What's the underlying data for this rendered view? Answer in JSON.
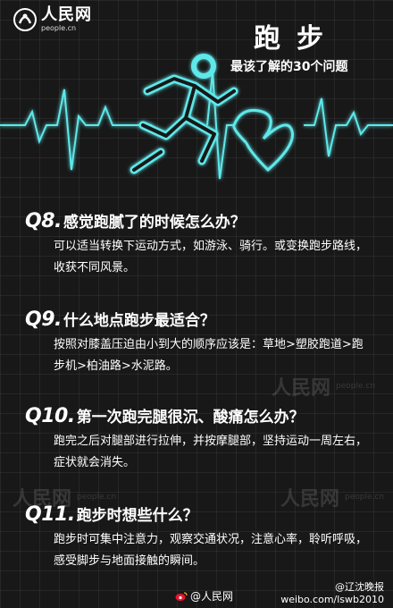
{
  "header": {
    "logo_name": "人民网",
    "logo_domain": "people.cn",
    "title": "跑步",
    "subtitle": "最该了解的30个问题"
  },
  "questions": [
    {
      "number": "Q8.",
      "question": "感觉跑腻了的时候怎么办？",
      "answer": "可以适当转换下运动方式，如游泳、骑行。或变换跑步路线，收获不同风景。"
    },
    {
      "number": "Q9.",
      "question": "什么地点跑步最适合？",
      "answer": "按照对膝盖压迫由小到大的顺序应该是：草地>塑胶跑道>跑步机>柏油路>水泥路。"
    },
    {
      "number": "Q10.",
      "question": "第一次跑完腿很沉、酸痛怎么办？",
      "answer": "跑完之后对腿部进行拉伸，并按摩腿部，坚持运动一周左右，症状就会消失。"
    },
    {
      "number": "Q11.",
      "question": "跑步时想些什么？",
      "answer": "跑步时可集中注意力，观察交通状况，注意心率，聆听呼吸，感受脚步与地面接触的瞬间。"
    }
  ],
  "footer": {
    "source": "@人民网",
    "weibo_account": "@辽沈晚报",
    "weibo_url": "weibo.com/lswb2010"
  },
  "colors": {
    "accent": "#5fe8ea",
    "background": "#181818",
    "text": "#ffffff"
  },
  "icons": [
    "people-logo-icon",
    "runner-icon",
    "heart-icon",
    "ecg-line-icon",
    "weibo-icon"
  ]
}
